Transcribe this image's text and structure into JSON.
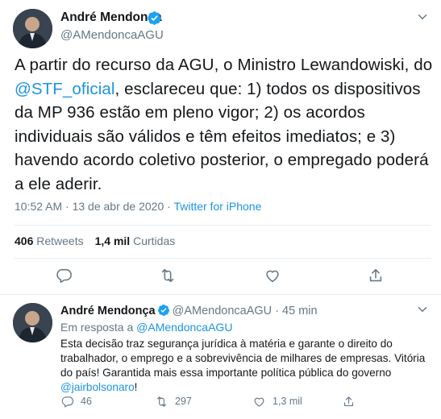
{
  "tweet": {
    "author_name": "André Mendonça",
    "author_handle": "@AMendoncaAGU",
    "text_before": "A partir do recurso da AGU, o Ministro Lewandowiski, do ",
    "mention": "@STF_oficial",
    "text_after": ", esclareceu que: 1) todos os dispositivos da MP 936 estão em pleno vigor; 2) os acordos individuais são válidos e têm efeitos imediatos; e 3) havendo acordo coletivo posterior, o empregado poderá a ele aderir.",
    "timestamp": "10:52 AM · 13 de abr de 2020 · ",
    "client": "Twitter for iPhone",
    "retweets_count": "406",
    "retweets_label": "Retweets",
    "likes_count": "1,4 mil",
    "likes_label": "Curtidas"
  },
  "reply": {
    "author_name": "André Mendonça",
    "author_handle": "@AMendoncaAGU",
    "time": "· 45 min",
    "reply_to_prefix": "Em resposta a ",
    "reply_to_handle": "@AMendoncaAGU",
    "text": "Esta decisão traz segurança jurídica à matéria e garante o direito do trabalhador, o emprego e a sobrevivência de milhares de empresas. Vitória do país! Garantida mais essa importante política pública do governo ",
    "mention": "@jairbolsonaro",
    "text_end": "!",
    "replies": "46",
    "retweets": "297",
    "likes": "1,3 mil"
  },
  "colors": {
    "accent": "#1b95e0",
    "muted": "#657786",
    "text": "#14171a",
    "border": "#e6ecf0"
  },
  "icons": [
    "verified-icon",
    "chevron-down-icon",
    "reply-icon",
    "retweet-icon",
    "like-icon",
    "share-icon"
  ]
}
